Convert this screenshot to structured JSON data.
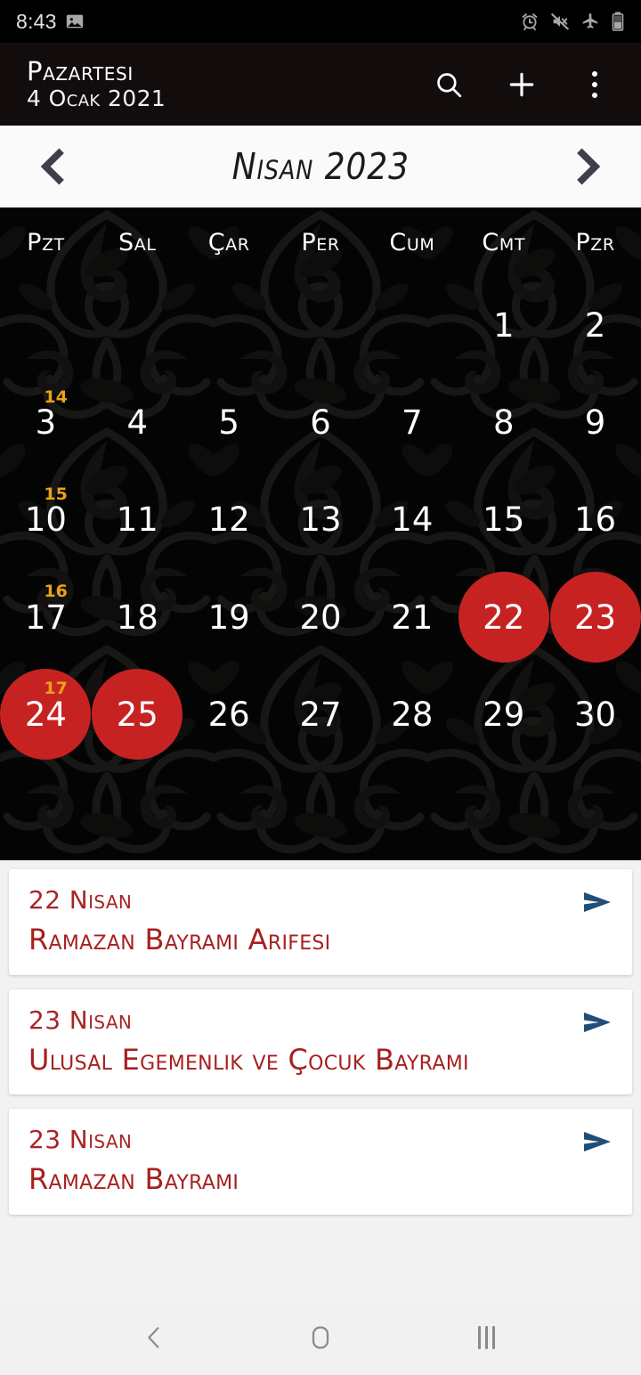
{
  "statusbar": {
    "time": "8:43",
    "icons": [
      "image-icon",
      "alarm-icon",
      "sound-muted-icon",
      "airplane-mode-icon",
      "battery-icon"
    ]
  },
  "appbar": {
    "day_label": "Pazartesi",
    "date_label": "4 Ocak 2021",
    "actions": [
      "search-icon",
      "add-icon",
      "overflow-menu-icon"
    ]
  },
  "monthbar": {
    "prev_label": "‹",
    "title": "Nisan 2023",
    "next_label": "›"
  },
  "calendar": {
    "weekdays": [
      "Pzt",
      "Sal",
      "Çar",
      "Per",
      "Cum",
      "Cmt",
      "Pzr"
    ],
    "weeks": [
      {
        "weeknum": "",
        "days": [
          {
            "n": "",
            "hl": false
          },
          {
            "n": "",
            "hl": false
          },
          {
            "n": "",
            "hl": false
          },
          {
            "n": "",
            "hl": false
          },
          {
            "n": "",
            "hl": false
          },
          {
            "n": "1",
            "hl": false
          },
          {
            "n": "2",
            "hl": false
          }
        ]
      },
      {
        "weeknum": "14",
        "days": [
          {
            "n": "3",
            "hl": false
          },
          {
            "n": "4",
            "hl": false
          },
          {
            "n": "5",
            "hl": false
          },
          {
            "n": "6",
            "hl": false
          },
          {
            "n": "7",
            "hl": false
          },
          {
            "n": "8",
            "hl": false
          },
          {
            "n": "9",
            "hl": false
          }
        ]
      },
      {
        "weeknum": "15",
        "days": [
          {
            "n": "10",
            "hl": false
          },
          {
            "n": "11",
            "hl": false
          },
          {
            "n": "12",
            "hl": false
          },
          {
            "n": "13",
            "hl": false
          },
          {
            "n": "14",
            "hl": false
          },
          {
            "n": "15",
            "hl": false
          },
          {
            "n": "16",
            "hl": false
          }
        ]
      },
      {
        "weeknum": "16",
        "days": [
          {
            "n": "17",
            "hl": false
          },
          {
            "n": "18",
            "hl": false
          },
          {
            "n": "19",
            "hl": false
          },
          {
            "n": "20",
            "hl": false
          },
          {
            "n": "21",
            "hl": false
          },
          {
            "n": "22",
            "hl": true
          },
          {
            "n": "23",
            "hl": true
          }
        ]
      },
      {
        "weeknum": "17",
        "days": [
          {
            "n": "24",
            "hl": true
          },
          {
            "n": "25",
            "hl": true
          },
          {
            "n": "26",
            "hl": false
          },
          {
            "n": "27",
            "hl": false
          },
          {
            "n": "28",
            "hl": false
          },
          {
            "n": "29",
            "hl": false
          },
          {
            "n": "30",
            "hl": false
          }
        ]
      },
      {
        "weeknum": "",
        "days": [
          {
            "n": "",
            "hl": false
          },
          {
            "n": "",
            "hl": false
          },
          {
            "n": "",
            "hl": false
          },
          {
            "n": "",
            "hl": false
          },
          {
            "n": "",
            "hl": false
          },
          {
            "n": "",
            "hl": false
          },
          {
            "n": "",
            "hl": false
          }
        ]
      }
    ]
  },
  "events": [
    {
      "date": "22 Nisan",
      "title": "Ramazan Bayramı Arifesi",
      "share_icon": "share-arrow-icon"
    },
    {
      "date": "23 Nisan",
      "title": "Ulusal Egemenlik ve Çocuk Bayramı",
      "share_icon": "share-arrow-icon"
    },
    {
      "date": "23 Nisan",
      "title": "Ramazan Bayramı",
      "share_icon": "share-arrow-icon"
    }
  ],
  "navbar": {
    "back": "back-icon",
    "home": "home-icon",
    "recents": "recents-icon"
  },
  "colors": {
    "appbar_bg": "#120C0C",
    "highlight_red": "#C62222",
    "event_red": "#A81F1F",
    "week_number_gold": "#E8A317",
    "share_blue": "#1F4E79",
    "page_bg": "#F2F2F2",
    "monthbar_bg": "#FAFAFA"
  }
}
